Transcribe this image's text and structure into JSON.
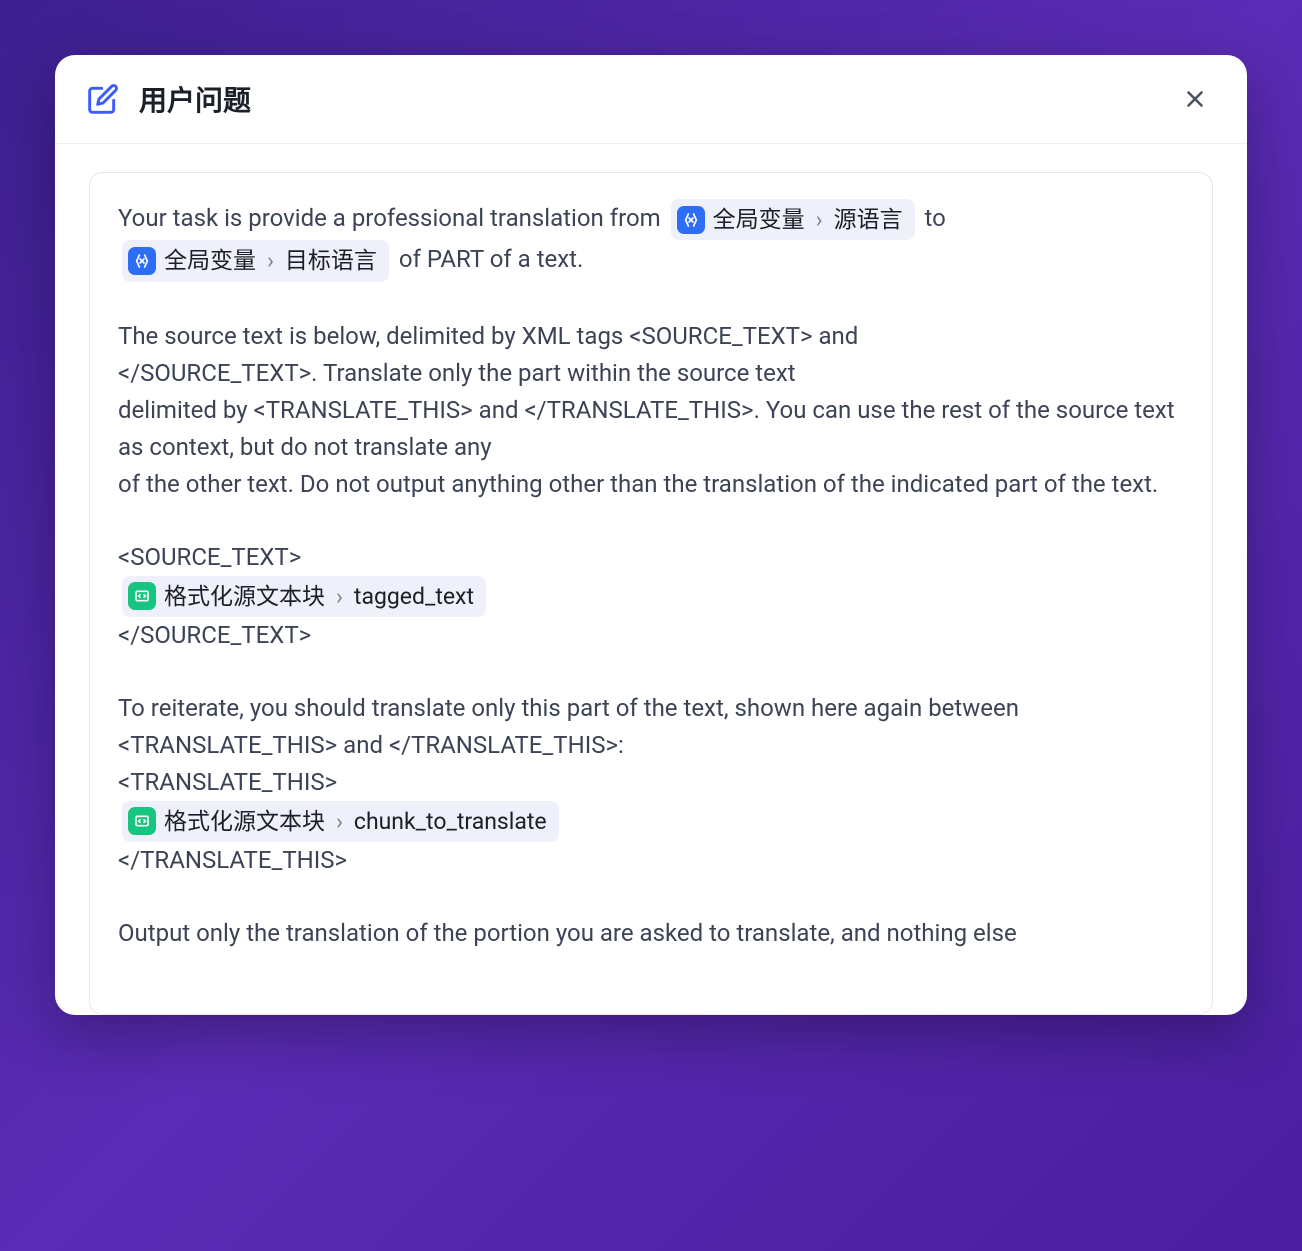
{
  "header": {
    "title": "用户问题"
  },
  "content": {
    "line1_pre": "Your task is provide a professional translation from ",
    "line1_post": " to ",
    "line2_post": " of PART of a text.",
    "para2_l1": "The source text is below, delimited by XML tags <SOURCE_TEXT> and",
    "para2_l2": "</SOURCE_TEXT>. Translate only the part within the source text",
    "para2_l3": "delimited by <TRANSLATE_THIS> and </TRANSLATE_THIS>. You can use the rest of the source text as context, but do not translate any",
    "para2_l4": "of the other text. Do not output anything other than the translation of the indicated part of the text.",
    "source_open": "<SOURCE_TEXT>",
    "source_close": "</SOURCE_TEXT>",
    "para4_l1": "To reiterate, you should translate only this part of the text, shown here again between <TRANSLATE_THIS> and </TRANSLATE_THIS>:",
    "trans_open": "<TRANSLATE_THIS>",
    "trans_close": "</TRANSLATE_THIS>",
    "para5": "Output only the translation of the portion you are asked to translate, and nothing else"
  },
  "variables": {
    "global_src": {
      "category": "全局变量",
      "name": "源语言"
    },
    "global_tgt": {
      "category": "全局变量",
      "name": "目标语言"
    },
    "block_tagged": {
      "category": "格式化源文本块",
      "name": "tagged_text"
    },
    "block_chunk": {
      "category": "格式化源文本块",
      "name": "chunk_to_translate"
    }
  }
}
